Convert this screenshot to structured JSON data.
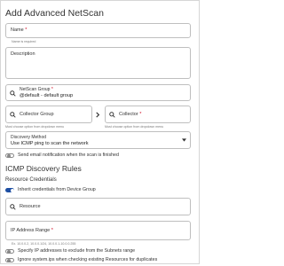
{
  "page_title": "Add Advanced NetScan",
  "name_field": {
    "label": "Name",
    "required_mark": "*",
    "value": "",
    "hint": "Name is required"
  },
  "description_field": {
    "label": "Description",
    "value": ""
  },
  "netscan_group": {
    "label": "NetScan Group",
    "required_mark": "*",
    "value": "@default - default group"
  },
  "collector_group": {
    "label": "Collector Group",
    "value": "",
    "hint": "Must choose option from dropdown menu"
  },
  "collector": {
    "label": "Collector",
    "required_mark": "*",
    "value": "",
    "hint": "Must choose option from dropdown menu"
  },
  "discovery_method": {
    "label": "Discovery Method",
    "value": "Use ICMP ping to scan the network"
  },
  "toggle_email": {
    "label": "Send email notification when the scan is finished",
    "on": false
  },
  "section_title": "ICMP Discovery Rules",
  "resource_credentials": "Resource Credentials",
  "toggle_inherit": {
    "label": "Inherit credentials from Device Group",
    "on": true
  },
  "resource_field": {
    "label": "Resource",
    "value": ""
  },
  "ip_range": {
    "label": "IP Address Range",
    "required_mark": "*",
    "value": "",
    "hint": "Ex. 10.0.0.2, 10.0.0.1/24, 10.0.0.1-10.0.0.255"
  },
  "toggle_exclude": {
    "label": "Specify IP addresses to exclude from the Subnets range",
    "on": false
  },
  "toggle_ignore": {
    "label": "Ignore system.ips when checking existing Resources for duplicates",
    "on": false
  },
  "colors": {
    "accent": "#1e4fa3",
    "border": "#bfbfbf",
    "required": "#d0021b"
  }
}
